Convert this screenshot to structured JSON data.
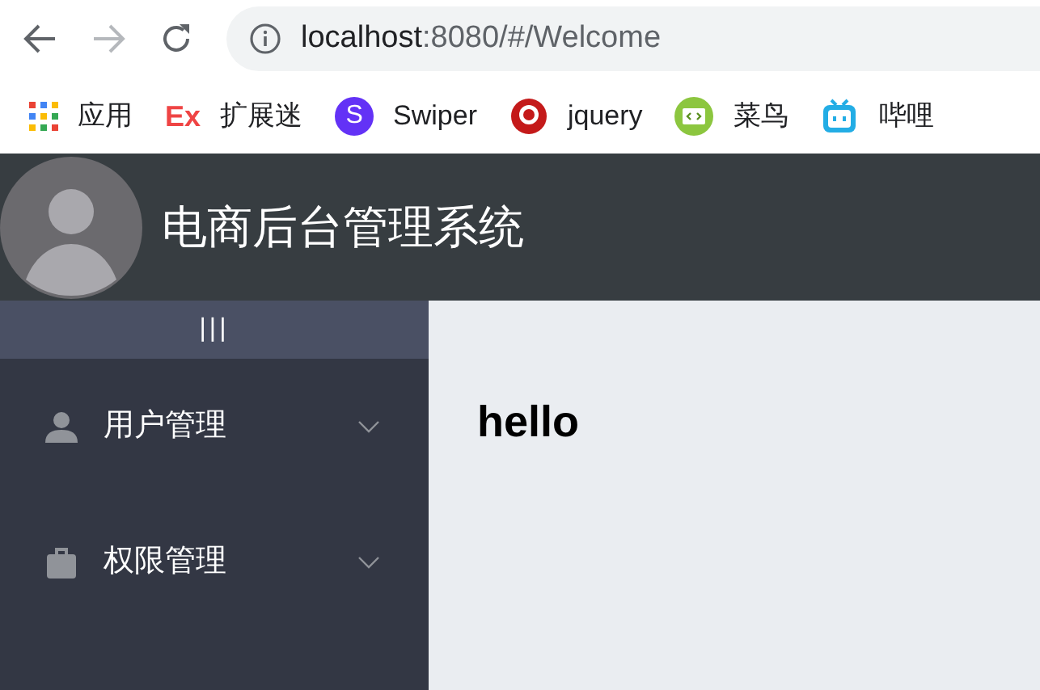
{
  "browser": {
    "url_host": "localhost",
    "url_path": ":8080/#/Welcome"
  },
  "bookmarks": [
    {
      "kind": "apps",
      "label": "应用"
    },
    {
      "kind": "letter",
      "icon_text": "Ex",
      "label": "扩展迷"
    },
    {
      "kind": "circle-letter",
      "icon_text": "S",
      "label": "Swiper"
    },
    {
      "kind": "ring",
      "label": "jquery"
    },
    {
      "kind": "code",
      "label": "菜鸟"
    },
    {
      "kind": "tv",
      "label": "哔哩"
    }
  ],
  "header": {
    "title": "电商后台管理系统"
  },
  "sidebar": {
    "toggle": "|||",
    "items": [
      {
        "kind": "user",
        "label": "用户管理",
        "expanded": false
      },
      {
        "kind": "bag",
        "label": "权限管理",
        "expanded": false
      }
    ]
  },
  "main": {
    "heading": "hello"
  }
}
